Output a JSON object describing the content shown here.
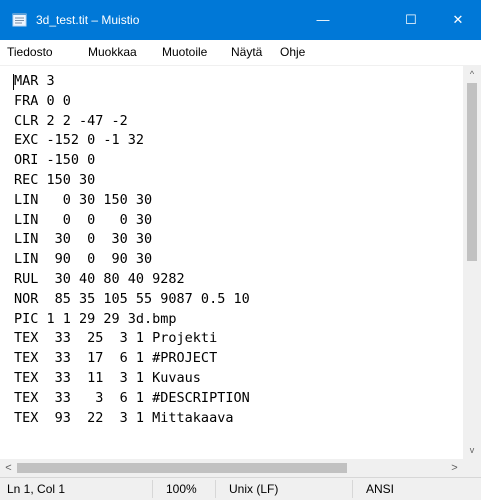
{
  "window": {
    "title": "3d_test.tit – Muistio",
    "icon": "notepad-icon",
    "minimize_glyph": "—",
    "maximize_glyph": "☐",
    "close_glyph": "✕"
  },
  "menu": [
    "Tiedosto",
    "Muokkaa",
    "Muotoile",
    "Näytä",
    "Ohje"
  ],
  "editor": {
    "lines": [
      "MAR 3",
      "FRA 0 0",
      "CLR 2 2 -47 -2",
      "EXC -152 0 -1 32",
      "ORI -150 0",
      "REC 150 30",
      "LIN   0 30 150 30",
      "LIN   0  0   0 30",
      "LIN  30  0  30 30",
      "LIN  90  0  90 30",
      "RUL  30 40 80 40 9282",
      "NOR  85 35 105 55 9087 0.5 10",
      "PIC 1 1 29 29 3d.bmp",
      "TEX  33  25  3 1 Projekti",
      "TEX  33  17  6 1 #PROJECT",
      "TEX  33  11  3 1 Kuvaus",
      "TEX  33   3  6 1 #DESCRIPTION",
      "TEX  93  22  3 1 Mittakaava"
    ]
  },
  "scrollbars": {
    "up_glyph": "^",
    "down_glyph": "v",
    "left_glyph": "<",
    "right_glyph": ">"
  },
  "status": {
    "position": "Ln 1, Col 1",
    "zoom": "100%",
    "line_ending": "Unix (LF)",
    "encoding": "ANSI"
  },
  "colors": {
    "titlebar": "#0078d7",
    "chrome": "#f0f0f0"
  }
}
